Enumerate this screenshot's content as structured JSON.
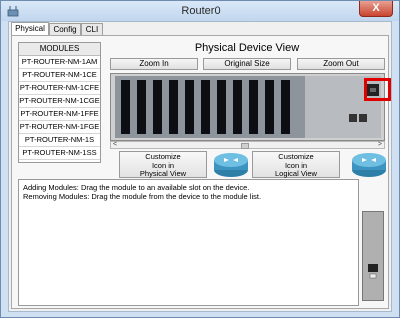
{
  "window": {
    "title": "Router0",
    "close_label": "X",
    "icon": "router-app-icon"
  },
  "tabs": [
    {
      "label": "Physical",
      "active": true
    },
    {
      "label": "Config",
      "active": false
    },
    {
      "label": "CLI",
      "active": false
    }
  ],
  "modules": {
    "header": "MODULES",
    "items": [
      "PT-ROUTER-NM-1AM",
      "PT-ROUTER-NM-1CE",
      "PT-ROUTER-NM-1CFE",
      "PT-ROUTER-NM-1CGE",
      "PT-ROUTER-NM-1FFE",
      "PT-ROUTER-NM-1FGE",
      "PT-ROUTER-NM-1S",
      "PT-ROUTER-NM-1SS"
    ]
  },
  "physical_view": {
    "title": "Physical Device View",
    "zoom_in": "Zoom In",
    "original_size": "Original Size",
    "zoom_out": "Zoom Out",
    "scroll_left": "<",
    "scroll_right": ">"
  },
  "customize": {
    "physical_button": "Customize\nIcon in\nPhysical View",
    "logical_button": "Customize\nIcon in\nLogical View"
  },
  "info": {
    "line1": "Adding Modules: Drag the module to an available slot on the device.",
    "line2": "Removing Modules: Drag the module from the device to the module list."
  },
  "colors": {
    "highlight": "#e00000",
    "close_button": "#c9452f",
    "router_icon": "#4a9fc8"
  }
}
